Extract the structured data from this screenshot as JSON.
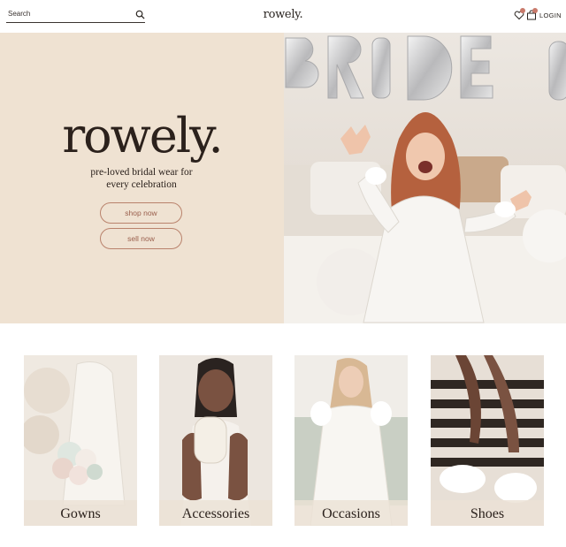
{
  "header": {
    "search_placeholder": "Search",
    "brand": "rowely.",
    "login_label": "LOGIN",
    "icons": {
      "search": "search-icon",
      "wishlist": "heart-icon",
      "cart": "bag-icon"
    }
  },
  "hero": {
    "brand": "rowely.",
    "tagline_line1": "pre-loved bridal wear for",
    "tagline_line2": "every celebration",
    "shop_button": "shop now",
    "sell_button": "sell now",
    "balloon_letters": [
      "B",
      "R",
      "I",
      "D",
      "E"
    ]
  },
  "categories": [
    {
      "label": "Gowns"
    },
    {
      "label": "Accessories"
    },
    {
      "label": "Occasions"
    },
    {
      "label": "Shoes"
    }
  ],
  "colors": {
    "hero_bg": "#efe2d2",
    "button_border": "#b9826c",
    "badge": "#c97a6b",
    "text": "#2b211c"
  }
}
